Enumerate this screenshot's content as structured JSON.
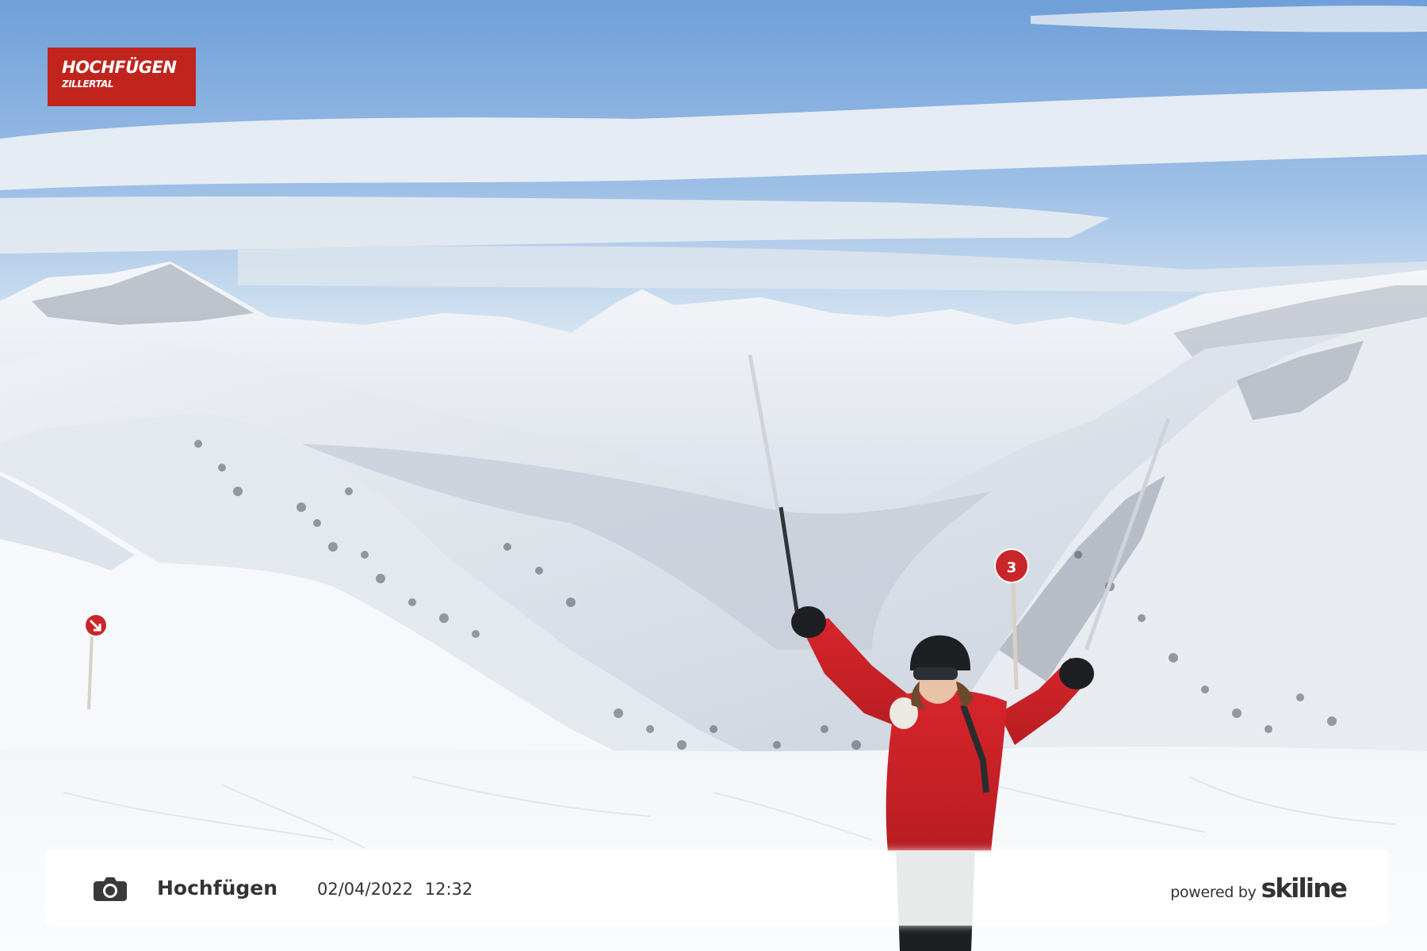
{
  "logo": {
    "line1": "HOCHFÜGEN",
    "line2": "ZILLERTAL",
    "color": "#c0241c"
  },
  "caption": {
    "icon": "camera-icon",
    "location": "Hochfügen",
    "date": "02/04/2022",
    "time": "12:32",
    "powered_by": "powered by",
    "brand": "skiline"
  },
  "sign": {
    "number": "3"
  }
}
